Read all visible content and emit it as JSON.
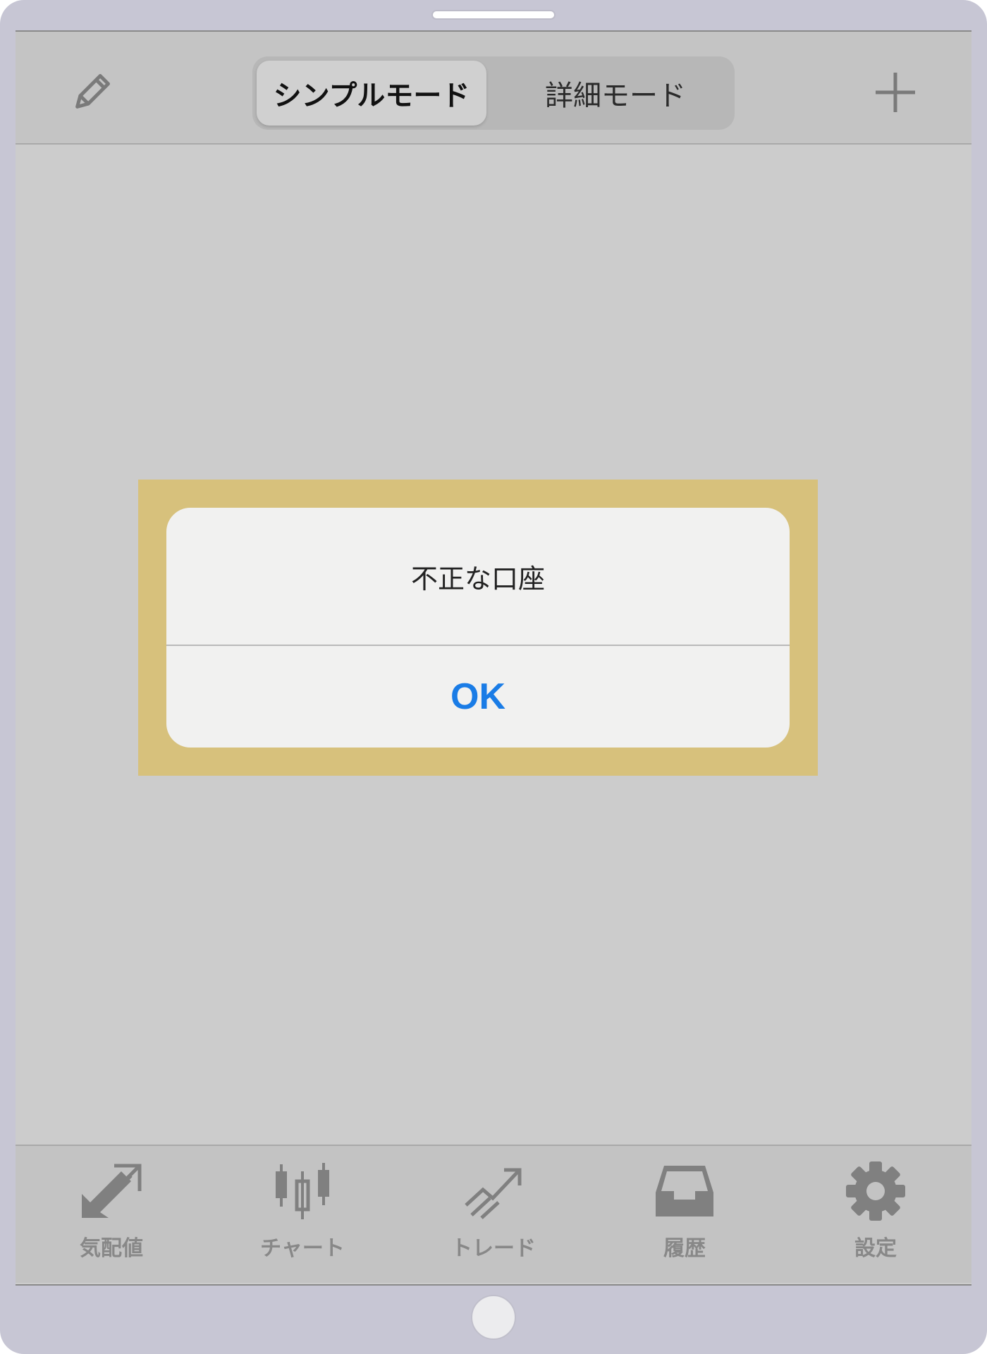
{
  "header": {
    "segments": [
      {
        "label": "シンプルモード",
        "selected": true
      },
      {
        "label": "詳細モード",
        "selected": false
      }
    ],
    "left_icon": "pencil-icon",
    "right_icon": "plus-icon"
  },
  "alert": {
    "message": "不正な口座",
    "ok_label": "OK"
  },
  "tabbar": {
    "items": [
      {
        "label": "気配値",
        "icon": "quotes-arrows-icon"
      },
      {
        "label": "チャート",
        "icon": "candlestick-icon"
      },
      {
        "label": "トレード",
        "icon": "trade-trend-icon"
      },
      {
        "label": "履歴",
        "icon": "inbox-tray-icon"
      },
      {
        "label": "設定",
        "icon": "gear-icon"
      }
    ]
  },
  "colors": {
    "device_frame": "#c7c6d4",
    "overlay_highlight": "#d7c17c",
    "alert_button": "#1a7ce6",
    "tab_inactive": "#888888"
  }
}
